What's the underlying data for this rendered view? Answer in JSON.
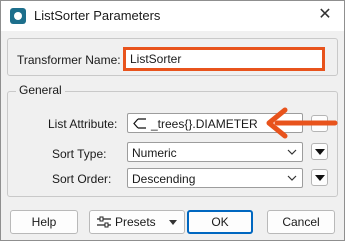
{
  "window": {
    "title": "ListSorter Parameters",
    "close_symbol": "✕"
  },
  "transformer": {
    "label": "Transformer Name:",
    "value": "ListSorter"
  },
  "general": {
    "group_title": "General",
    "list_attribute": {
      "label": "List Attribute:",
      "value": "_trees{}.DIAMETER"
    },
    "sort_type": {
      "label": "Sort Type:",
      "value": "Numeric"
    },
    "sort_order": {
      "label": "Sort Order:",
      "value": "Descending"
    }
  },
  "buttons": {
    "help": "Help",
    "presets": "Presets",
    "ok": "OK",
    "cancel": "Cancel"
  },
  "colors": {
    "highlight": "#e8531c",
    "ok_border": "#0067c0"
  },
  "icons": [
    "app-icon",
    "close-icon",
    "list-icon",
    "chevron-down-icon",
    "dropdown-triangle-icon",
    "presets-icon",
    "arrow-annotation"
  ]
}
